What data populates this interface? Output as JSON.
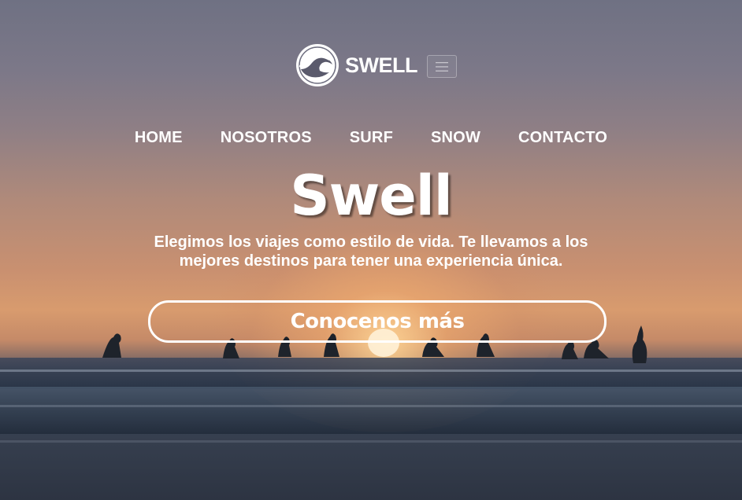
{
  "brand": {
    "name": "SWELL",
    "logo_icon": "wave-circle-icon"
  },
  "header": {
    "menu_icon": "hamburger-icon"
  },
  "nav": {
    "items": [
      {
        "label": "HOME"
      },
      {
        "label": "NOSOTROS"
      },
      {
        "label": "SURF"
      },
      {
        "label": "SNOW"
      },
      {
        "label": "CONTACTO"
      }
    ]
  },
  "hero": {
    "title": "Swell",
    "subtitle": "Elegimos los viajes como estilo de vida. Te llevamos a los mejores destinos para tener una experiencia única.",
    "cta_label": "Conocenos más",
    "background": "sunset-surfers-photo"
  },
  "colors": {
    "text": "#ffffff",
    "sky_top": "#6f7183",
    "sunset": "#d89b6e",
    "sea": "#2c3342"
  }
}
